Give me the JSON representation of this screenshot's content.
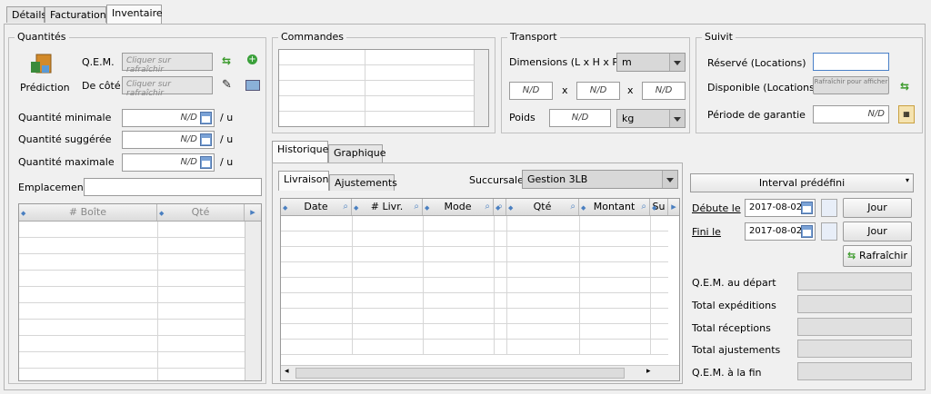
{
  "tabs": [
    "Détails",
    "Facturation",
    "Inventaire"
  ],
  "quantites": {
    "legend": "Quantités",
    "prediction_label": "Prédiction",
    "qem_label": "Q.E.M.",
    "qem_placeholder": "Cliquer sur rafraîchir",
    "decote_label": "De côté",
    "decote_placeholder": "Cliquer sur rafraîchir",
    "min_label": "Quantité minimale",
    "sugg_label": "Quantité suggérée",
    "max_label": "Quantité maximale",
    "nd": "N/D",
    "unit": "/ u",
    "emplacement_label": "Emplacement",
    "grid_headers": [
      "# Boîte",
      "Qté"
    ]
  },
  "commandes": {
    "legend": "Commandes"
  },
  "transport": {
    "legend": "Transport",
    "dim_label": "Dimensions (L x H x P)",
    "dim_unit": "m",
    "nd": "N/D",
    "x": "x",
    "poids_label": "Poids",
    "poids_unit": "kg"
  },
  "suivi": {
    "legend": "Suivit",
    "reserve_label": "Réservé (Locations)",
    "dispo_label": "Disponible (Locations)",
    "dispo_btn": "Rafraîchir pour afficher",
    "garantie_label": "Période de garantie",
    "nd": "N/D"
  },
  "historique": {
    "tabs": [
      "Historique",
      "Graphique"
    ],
    "subtabs": [
      "Livraisons",
      "Ajustements"
    ],
    "succursale_label": "Succursale",
    "succursale_value": "Gestion 3LB",
    "columns": [
      "Date",
      "# Livr.",
      "Mode",
      "",
      "Qté",
      "Montant",
      "Su"
    ]
  },
  "periode": {
    "interval": "Interval prédéfini",
    "debute_label": "Débute le",
    "fini_label": "Fini le",
    "debute_date": "2017-08-02",
    "fini_date": "2017-08-02",
    "jour": "Jour",
    "refresh": "Rafraîchir",
    "stats": [
      "Q.E.M. au départ",
      "Total expéditions",
      "Total réceptions",
      "Total ajustements",
      "Q.E.M. à la fin"
    ]
  }
}
